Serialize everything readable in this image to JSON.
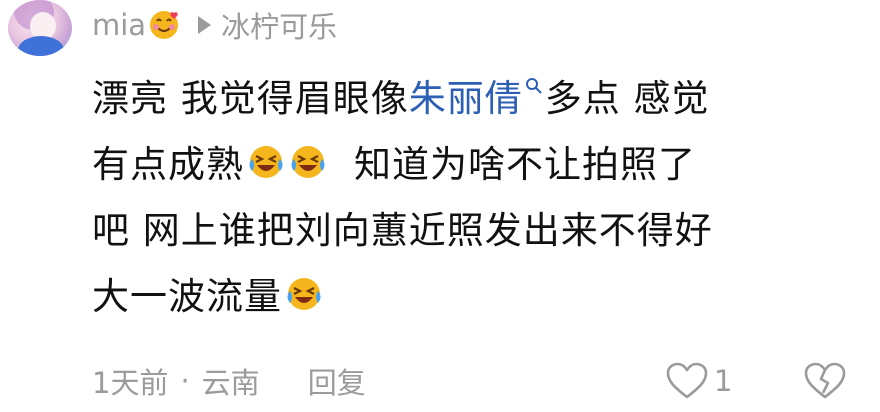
{
  "comment": {
    "username": "mia",
    "reply_to": "冰柠可乐",
    "line1_a": "漂亮  我觉得眉眼像",
    "line1_link": "朱丽倩",
    "line1_b": "多点   感觉",
    "line2_a": "有点成熟",
    "line2_b": "知道为啥不让拍照了",
    "line3": "吧   网上谁把刘向蕙近照发出来不得好",
    "line4": "大一波流量",
    "time": "1天前",
    "separator": "·",
    "location": "云南",
    "reply_label": "回复",
    "like_count": "1"
  },
  "colors": {
    "meta_text": "#9b9b9b",
    "body_text": "#111111",
    "link": "#2d5fb4",
    "emoji_face": "#f5b51c",
    "emoji_tear": "#4aa3f0"
  },
  "icons": {
    "reply_arrow": "play-triangle-icon",
    "search": "search-icon",
    "like": "heart-outline-icon",
    "dislike": "broken-heart-icon",
    "laugh_cry": "laughing-crying-emoji",
    "smiling_hearts": "smiling-face-with-hearts-emoji"
  }
}
